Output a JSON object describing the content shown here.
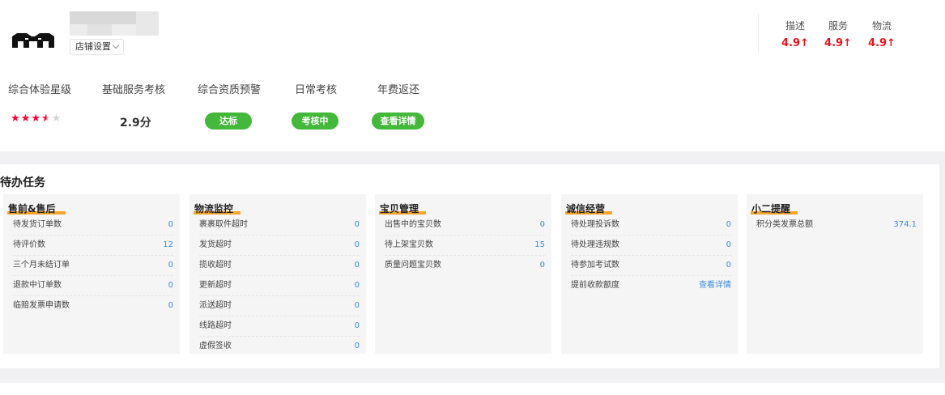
{
  "shop": {
    "settings_label": "店铺设置"
  },
  "ratings": [
    {
      "label": "描述",
      "value": "4.9↑"
    },
    {
      "label": "服务",
      "value": "4.9↑"
    },
    {
      "label": "物流",
      "value": "4.9↑"
    }
  ],
  "metrics": {
    "experience_label": "综合体验星级",
    "experience_stars": 3.5,
    "basic_label": "基础服务考核",
    "basic_value": "2.9分",
    "qualification_label": "综合资质预警",
    "qualification_status": "达标",
    "daily_label": "日常考核",
    "daily_status": "考核中",
    "fee_label": "年费返还",
    "fee_action": "查看详情"
  },
  "todo": {
    "title": "待办任务",
    "columns": [
      {
        "title": "售前&售后",
        "rows": [
          {
            "label": "待发货订单数",
            "value": "0"
          },
          {
            "label": "待评价数",
            "value": "12"
          },
          {
            "label": "三个月未结订单",
            "value": "0"
          },
          {
            "label": "退款中订单数",
            "value": "0"
          },
          {
            "label": "临赔发票申请数",
            "value": "0"
          }
        ]
      },
      {
        "title": "物流监控",
        "rows": [
          {
            "label": "裹裹取件超时",
            "value": "0"
          },
          {
            "label": "发货超时",
            "value": "0"
          },
          {
            "label": "揽收超时",
            "value": "0"
          },
          {
            "label": "更新超时",
            "value": "0"
          },
          {
            "label": "派送超时",
            "value": "0"
          },
          {
            "label": "线路超时",
            "value": "0"
          },
          {
            "label": "虚假签收",
            "value": "0"
          }
        ]
      },
      {
        "title": "宝贝管理",
        "rows": [
          {
            "label": "出售中的宝贝数",
            "value": "0"
          },
          {
            "label": "待上架宝贝数",
            "value": "15"
          },
          {
            "label": "质量问题宝贝数",
            "value": "0"
          }
        ]
      },
      {
        "title": "诚信经营",
        "rows": [
          {
            "label": "待处理投诉数",
            "value": "0"
          },
          {
            "label": "待处理违规数",
            "value": "0"
          },
          {
            "label": "待参加考试数",
            "value": "0"
          },
          {
            "label": "提前收款额度",
            "value": "查看详情"
          }
        ]
      },
      {
        "title": "小二提醒",
        "rows": [
          {
            "label": "积分类发票总额",
            "value": "374.1"
          }
        ]
      }
    ]
  },
  "colors": {
    "rating_red": "#e8141c",
    "star_red": "#ff0036",
    "pill_green": "#43b83a",
    "link_blue": "#3c8ae6",
    "heading_highlight": "#f4a52a"
  }
}
